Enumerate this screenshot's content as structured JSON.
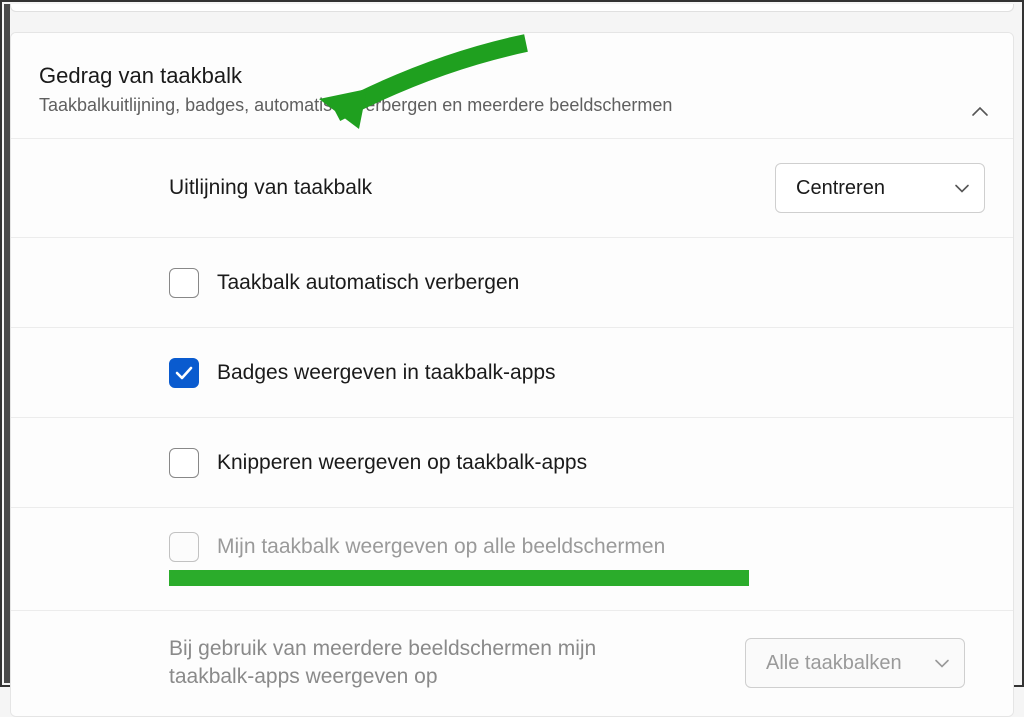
{
  "header": {
    "title": "Gedrag van taakbalk",
    "subtitle": "Taakbalkuitlijning, badges, automatisch verbergen en meerdere beeldschermen"
  },
  "rows": {
    "alignment": {
      "label": "Uitlijning van taakbalk",
      "selected": "Centreren"
    },
    "autohide": {
      "label": "Taakbalk automatisch verbergen"
    },
    "badges": {
      "label": "Badges weergeven in taakbalk-apps"
    },
    "flash": {
      "label": "Knipperen weergeven op taakbalk-apps"
    },
    "allmonitors": {
      "label": "Mijn taakbalk weergeven op alle beeldschermen"
    },
    "multi": {
      "label": "Bij gebruik van meerdere beeldschermen mijn taakbalk-apps weergeven op",
      "selected": "Alle taakbalken"
    }
  }
}
